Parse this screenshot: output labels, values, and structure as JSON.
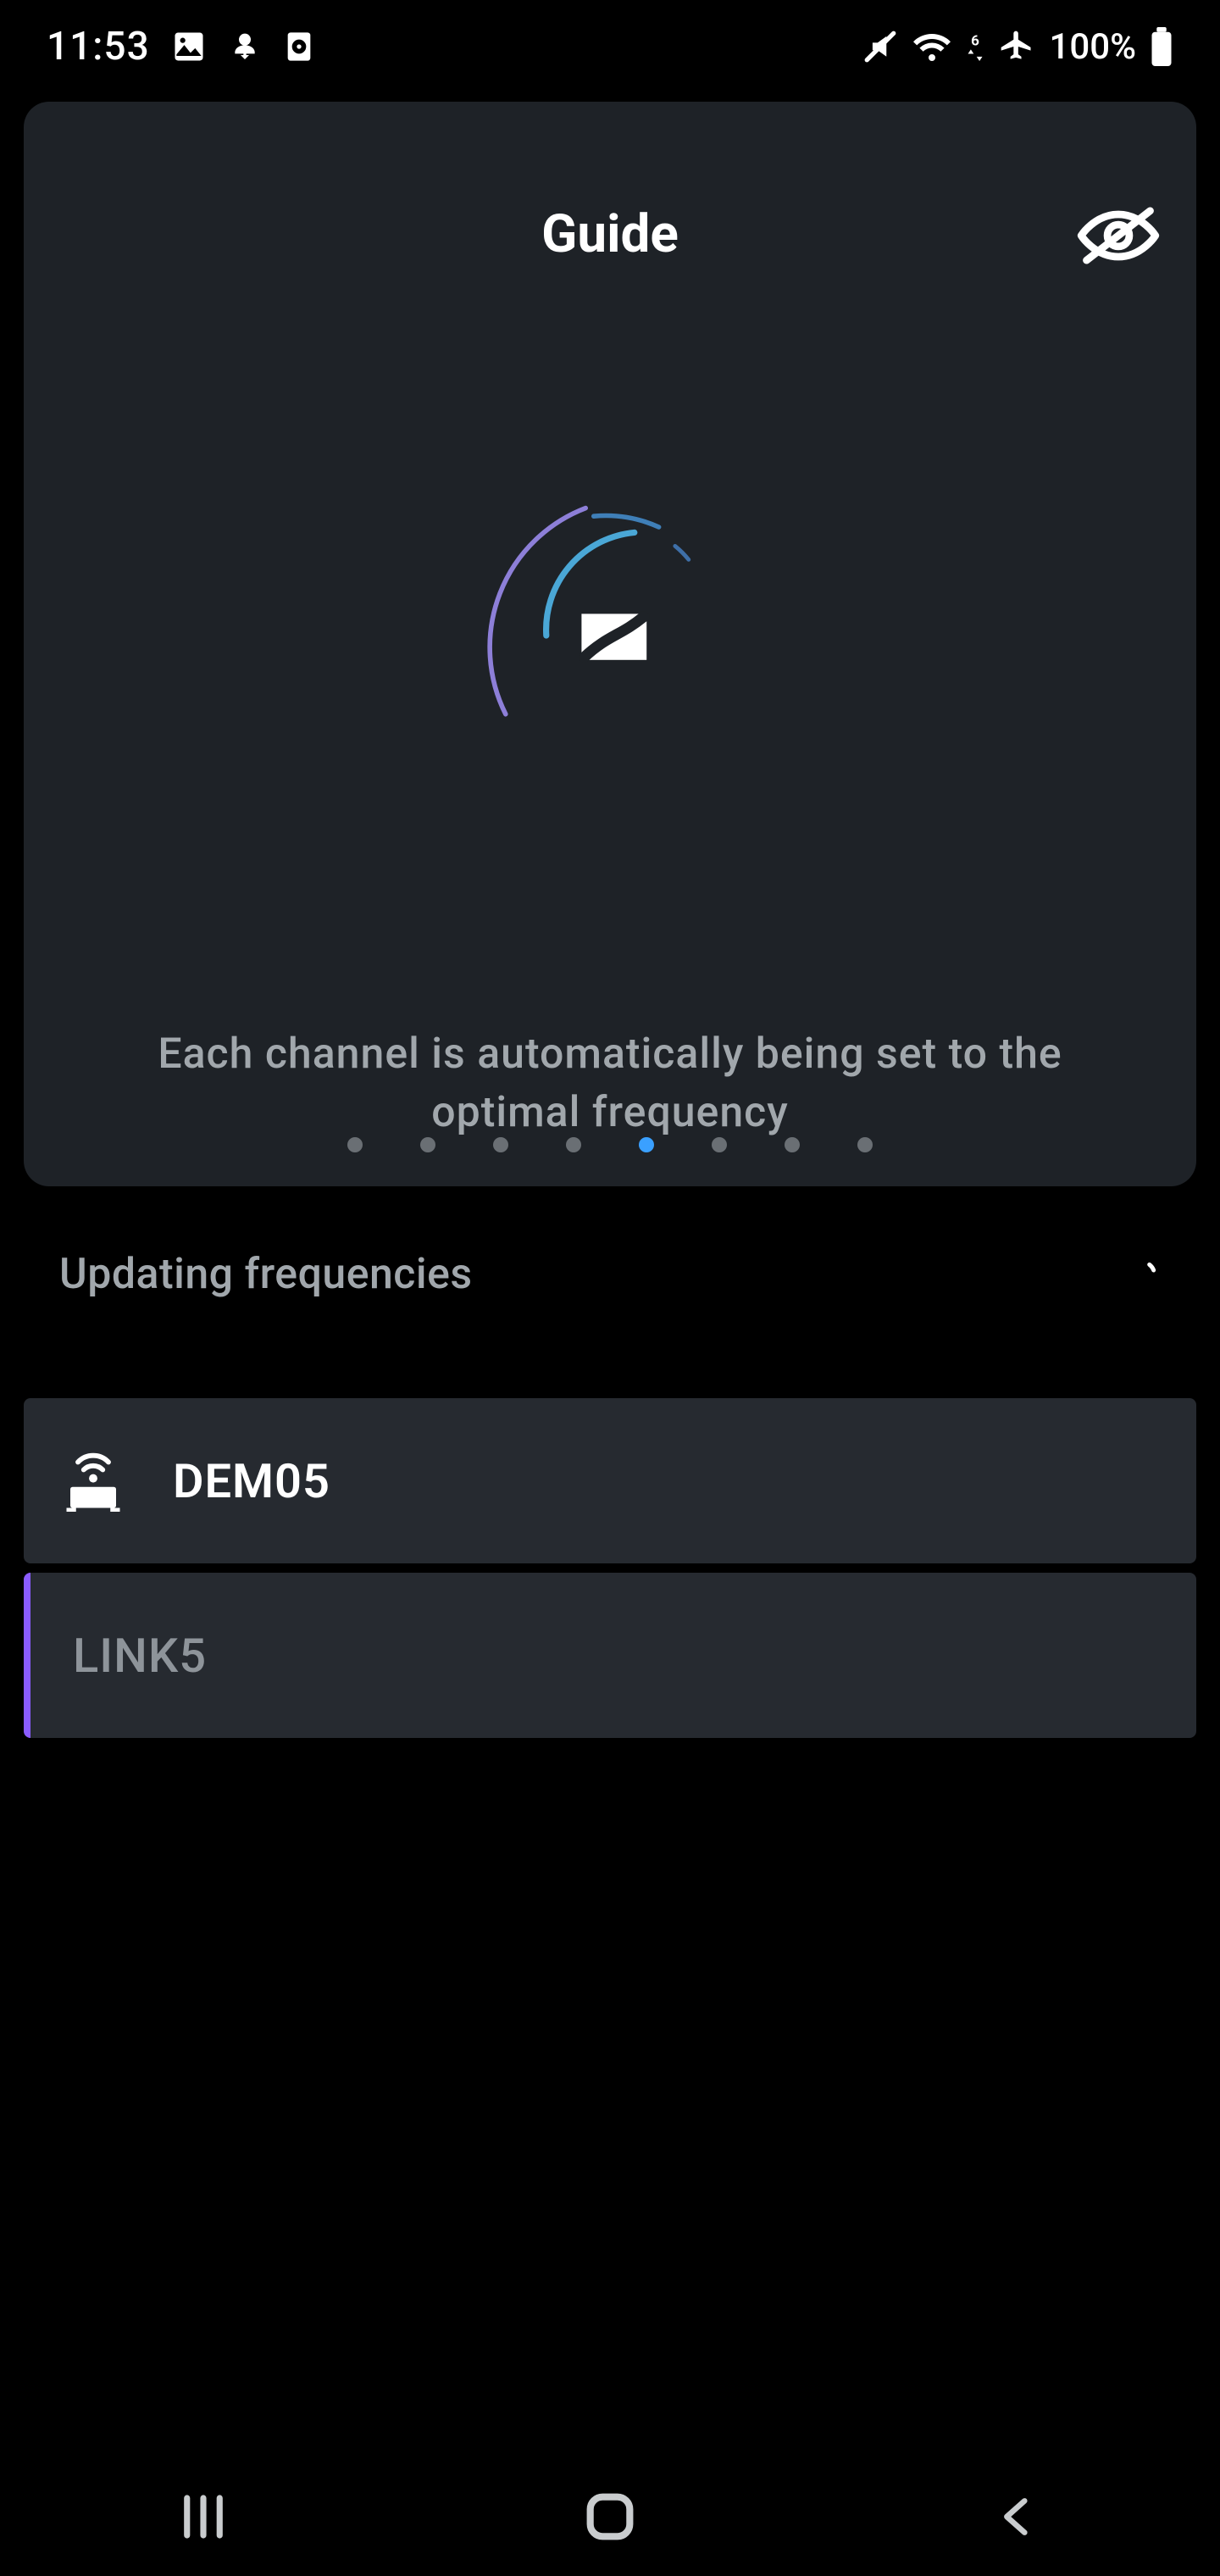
{
  "status": {
    "time": "11:53",
    "battery_pct": "100%"
  },
  "guide": {
    "title": "Guide",
    "text": "Each channel is automatically being set to the optimal frequency",
    "page_count": 8,
    "active_index": 4
  },
  "updating": {
    "label": "Updating frequencies"
  },
  "devices": [
    {
      "id": "DEM05",
      "label": "DEM05",
      "type": "receiver",
      "active": true
    },
    {
      "id": "LINK5",
      "label": "LINK5",
      "type": "link",
      "active": false
    }
  ],
  "colors": {
    "bg": "#000",
    "card": "#1e2227",
    "row": "#262a30",
    "text_dim": "#a1a7ac",
    "accent": "#3aa0ff",
    "link_accent": "#8a5cff"
  },
  "icons": {
    "gallery": "gallery-icon",
    "download": "download-icon",
    "file": "file-icon",
    "mute": "mute-icon",
    "wifi": "wifi-icon",
    "airplane": "airplane-icon",
    "battery": "battery-icon",
    "hide": "eye-off-icon",
    "logo": "sennheiser-icon",
    "receiver": "receiver-icon",
    "nav_recents": "recents-icon",
    "nav_home": "home-icon",
    "nav_back": "back-icon"
  }
}
